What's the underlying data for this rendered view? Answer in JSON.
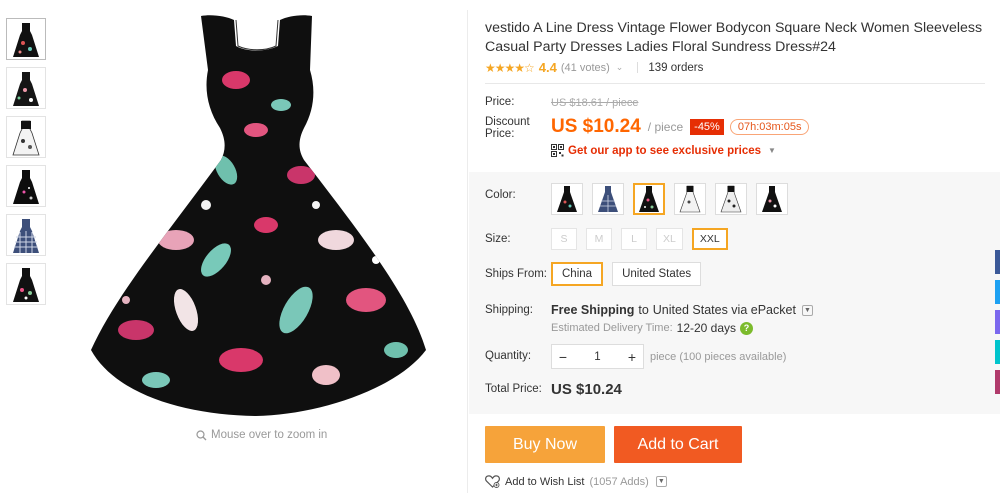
{
  "product": {
    "title": "vestido A Line Dress Vintage Flower Bodycon Square Neck Women Sleeveless Casual Party Dresses Ladies Floral Sundress Dress#24",
    "stars_icon": "star-rating-icons",
    "rating": "4.4",
    "votes": "(41 votes)",
    "orders": "139 orders"
  },
  "gallery": {
    "zoom_hint": "Mouse over to zoom in",
    "thumbnails": [
      "black-floral",
      "black-floral-2",
      "white-floral",
      "black-dots",
      "blue-plaid",
      "black-floral-3"
    ]
  },
  "pricing": {
    "price_label": "Price:",
    "original_price": "US $18.61 / piece",
    "discount_label_1": "Discount",
    "discount_label_2": "Price:",
    "discount_price": "US $10.24",
    "per_piece": "/ piece",
    "discount_percent": "-45%",
    "countdown": "07h:03m:05s",
    "app_link": "Get our app to see exclusive prices"
  },
  "options": {
    "color_label": "Color:",
    "size_label": "Size:",
    "sizes": [
      "S",
      "M",
      "L",
      "XL",
      "XXL"
    ],
    "selected_size": "XXL",
    "ships_from_label": "Ships From:",
    "ships_from": [
      "China",
      "United States"
    ],
    "shipping_label": "Shipping:",
    "shipping_bold": "Free Shipping",
    "shipping_to": "to",
    "shipping_dest": "United States via ePacket",
    "delivery_label": "Estimated Delivery Time:",
    "delivery_days": "12-20 days",
    "quantity_label": "Quantity:",
    "quantity_value": "1",
    "quantity_note": "piece (100 pieces available)",
    "total_label": "Total Price:",
    "total_value": "US $10.24"
  },
  "actions": {
    "buy_now": "Buy Now",
    "add_to_cart": "Add to Cart",
    "wishlist": "Add to Wish List",
    "wishlist_adds": "(1057 Adds)"
  },
  "colors": {
    "accent_orange": "#f60",
    "buy_now": "#f6a33a",
    "add_cart": "#f15a22",
    "selected_border": "#f5a623",
    "discount_red": "#e62e04"
  }
}
